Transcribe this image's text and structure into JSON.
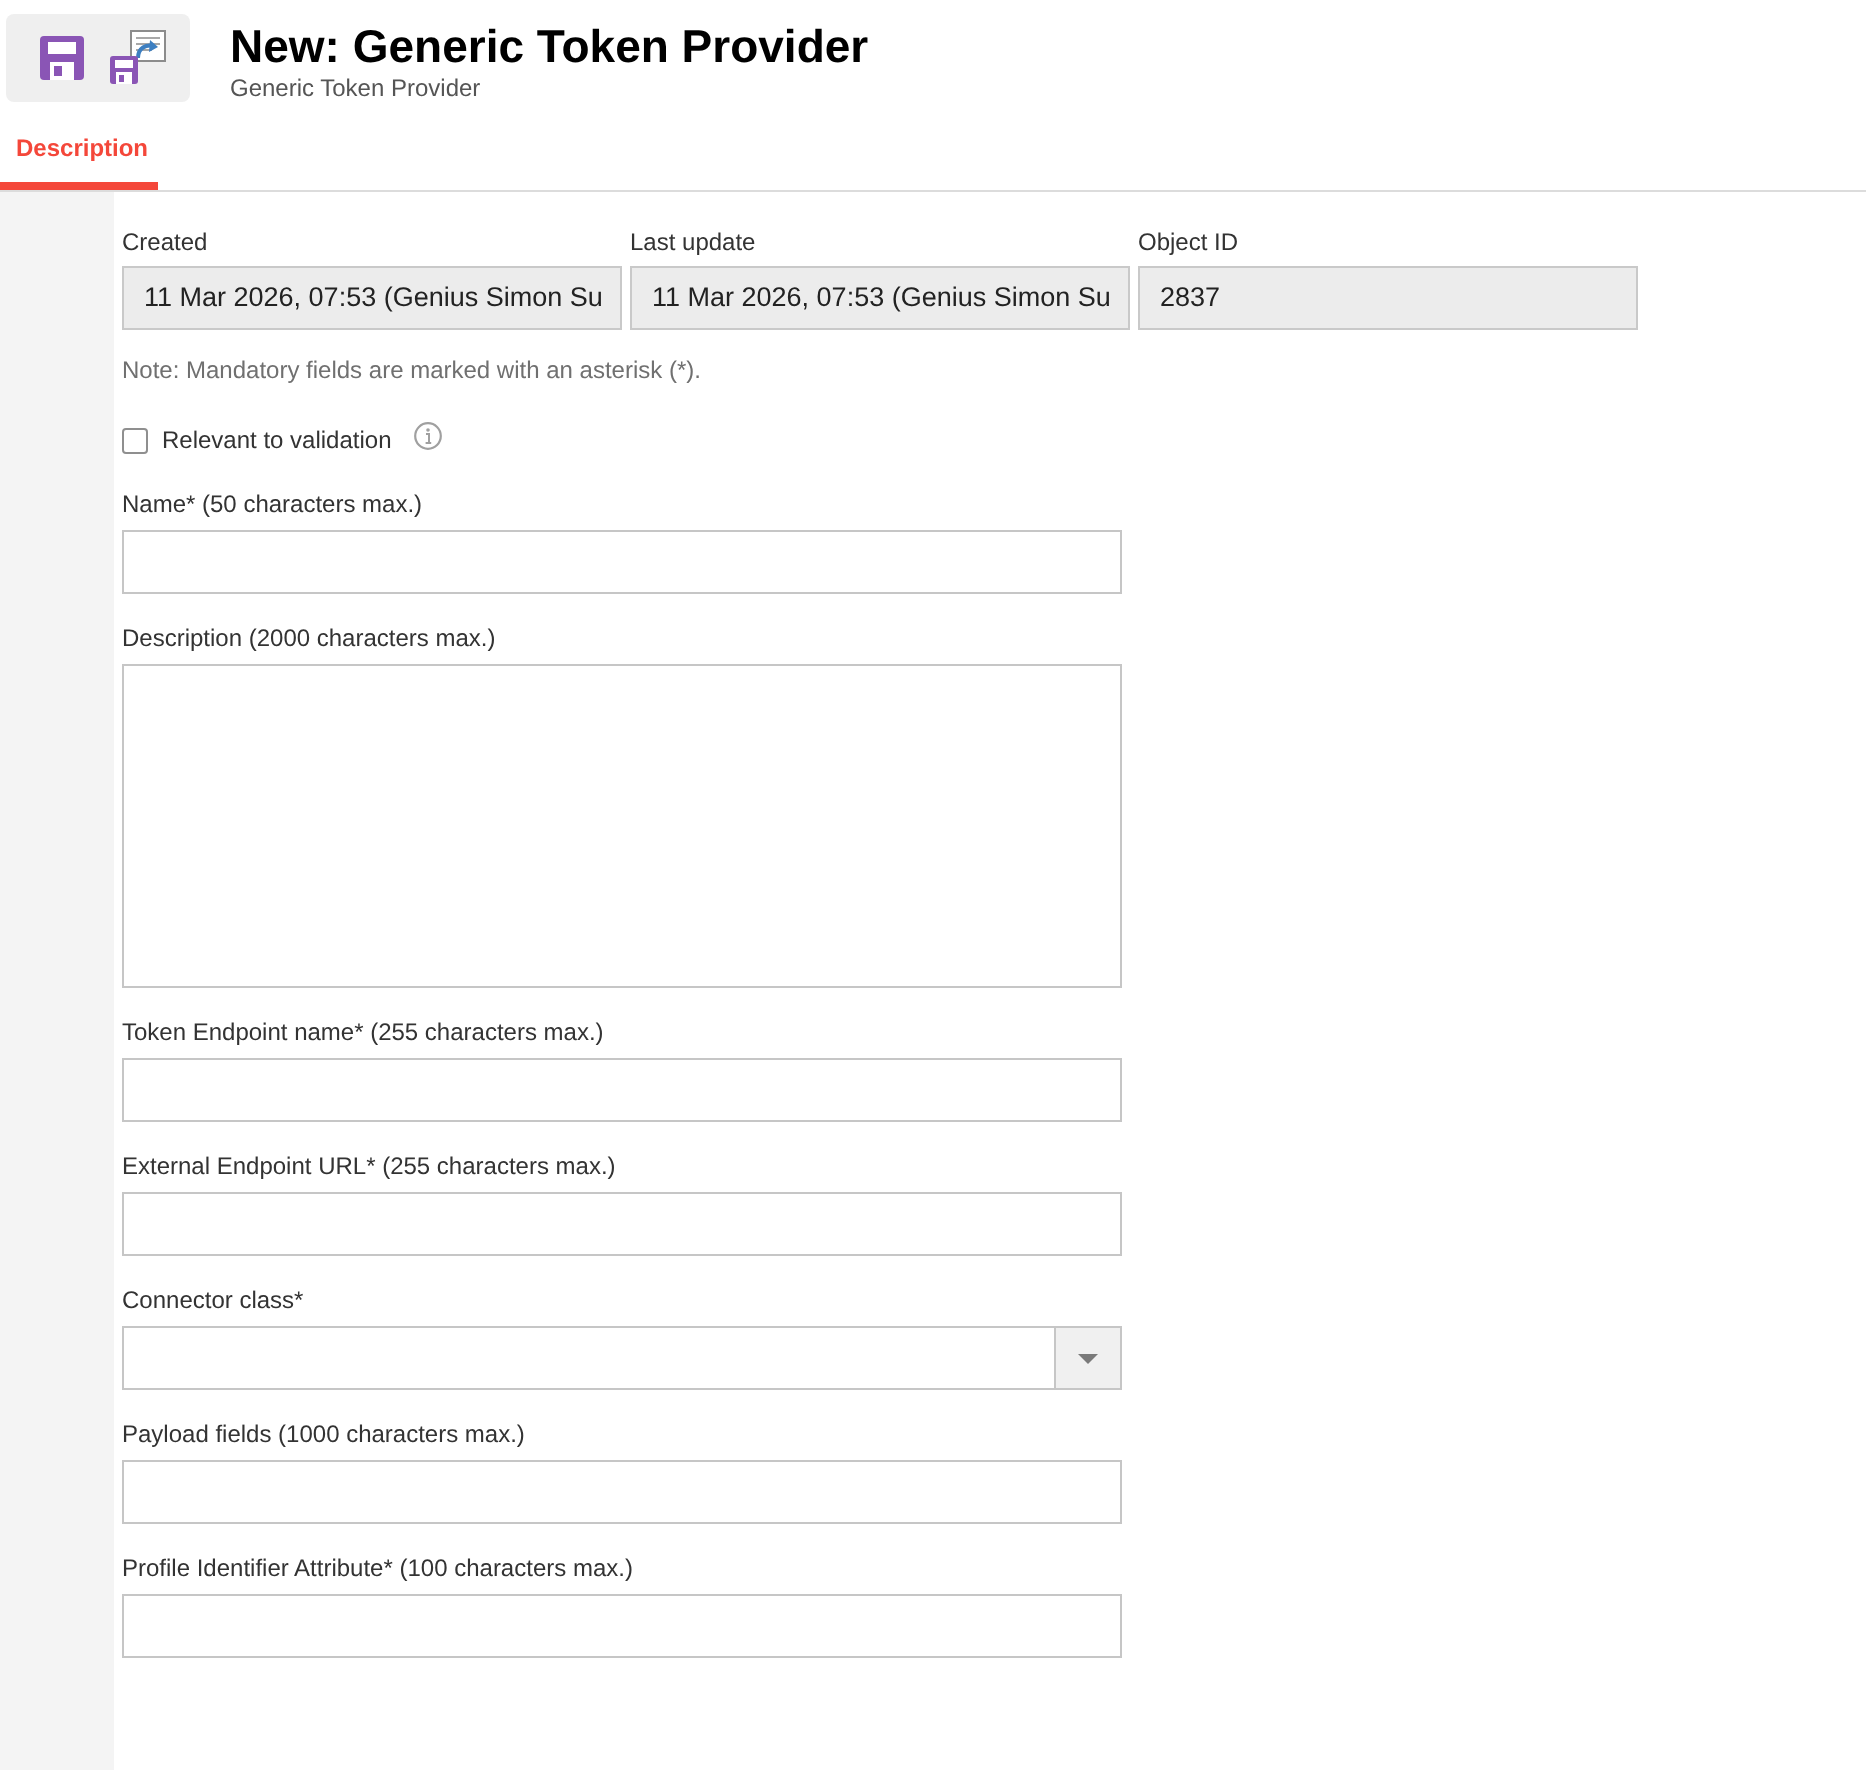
{
  "header": {
    "title": "New: Generic Token Provider",
    "subtitle": "Generic Token Provider"
  },
  "tabs": [
    {
      "label": "Description",
      "selected": true
    }
  ],
  "metadata": [
    {
      "label": "Created",
      "value": "11 Mar 2026, 07:53 (Genius Simon Su"
    },
    {
      "label": "Last update",
      "value": "11 Mar 2026, 07:53 (Genius Simon Su"
    },
    {
      "label": "Object ID",
      "value": "2837"
    }
  ],
  "note": "Note: Mandatory fields are marked with an asterisk (*).",
  "validation": {
    "label": "Relevant to validation",
    "checked": false
  },
  "fields": [
    {
      "kind": "text",
      "label": "Name* (50 characters max.)"
    },
    {
      "kind": "textarea",
      "label": "Description (2000 characters max.)"
    },
    {
      "kind": "text",
      "label": "Token Endpoint name* (255 characters max.)"
    },
    {
      "kind": "text",
      "label": "External Endpoint URL* (255 characters max.)"
    },
    {
      "kind": "select",
      "label": "Connector class*"
    },
    {
      "kind": "text",
      "label": "Payload fields (1000 characters max.)"
    },
    {
      "kind": "text",
      "label": "Profile Identifier Attribute* (100 characters max.)"
    }
  ]
}
